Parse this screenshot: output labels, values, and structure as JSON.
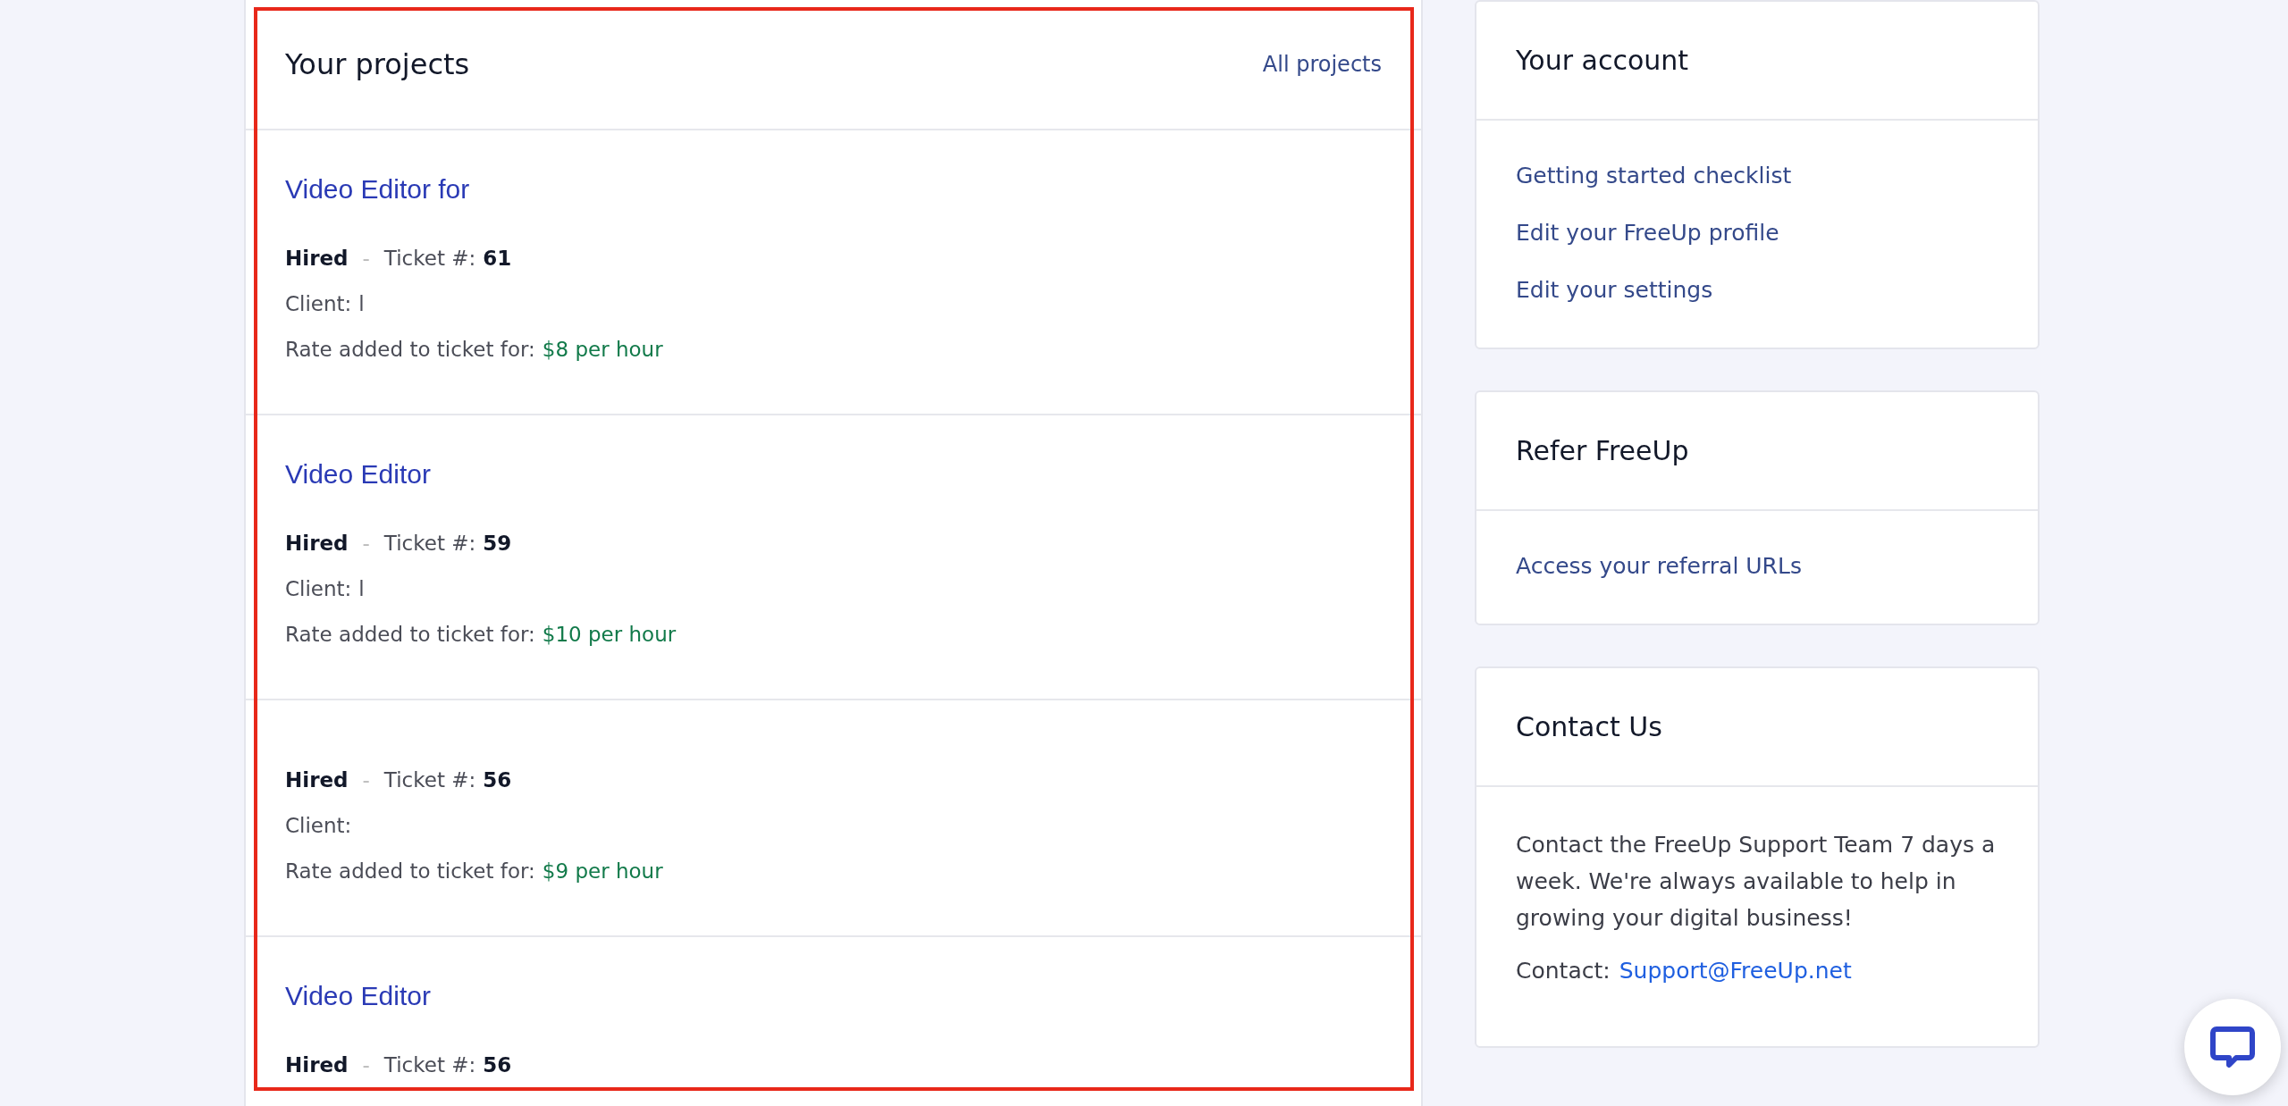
{
  "projects": {
    "title": "Your projects",
    "all_link": "All projects",
    "rows": [
      {
        "title": "Video Editor for",
        "status": "Hired",
        "separator": "-",
        "ticket_label": "Ticket #:",
        "ticket": "61",
        "client_label": "Client:",
        "client": "l",
        "rate_label": "Rate added to ticket for:",
        "rate": "$8 per hour"
      },
      {
        "title": "Video Editor",
        "status": "Hired",
        "separator": "-",
        "ticket_label": "Ticket #:",
        "ticket": "59",
        "client_label": "Client:",
        "client": "l",
        "rate_label": "Rate added to ticket for:",
        "rate": "$10 per hour"
      },
      {
        "status": "Hired",
        "separator": "-",
        "ticket_label": "Ticket #:",
        "ticket": "56",
        "client_label": "Client:",
        "rate_label": "Rate added to ticket for:",
        "rate": "$9 per hour"
      },
      {
        "title": "Video Editor",
        "status": "Hired",
        "separator": "-",
        "ticket_label": "Ticket #:",
        "ticket": "56"
      }
    ]
  },
  "account": {
    "title": "Your account",
    "links": [
      "Getting started checklist",
      "Edit your FreeUp profile",
      "Edit your settings"
    ]
  },
  "refer": {
    "title": "Refer FreeUp",
    "links": [
      "Access your referral URLs"
    ]
  },
  "contact": {
    "title": "Contact Us",
    "text": "Contact the FreeUp Support Team 7 days a week. We're always available to help in growing your digital business!",
    "contact_label": "Contact:",
    "email": "Support@FreeUp.net"
  }
}
